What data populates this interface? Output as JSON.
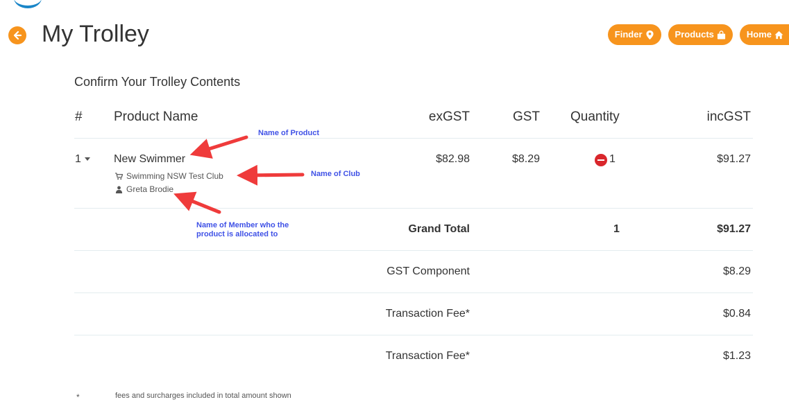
{
  "header": {
    "title": "My Trolley",
    "back_icon": "arrow-left-circle-icon",
    "nav": [
      {
        "label": "Finder",
        "icon": "map-marker-icon"
      },
      {
        "label": "Products",
        "icon": "shopping-bag-icon"
      },
      {
        "label": "Home",
        "icon": "home-icon"
      }
    ],
    "accent_color": "#f7941d"
  },
  "section_title": "Confirm Your Trolley Contents",
  "table": {
    "columns": [
      "#",
      "Product Name",
      "exGST",
      "GST",
      "Quantity",
      "incGST"
    ],
    "items": [
      {
        "index": "1",
        "product": "New Swimmer",
        "club": "Swimming NSW Test Club",
        "member": "Greta Brodie",
        "exgst": "$82.98",
        "gst": "$8.29",
        "quantity": "1",
        "incgst": "$91.27"
      }
    ],
    "grand_total": {
      "label": "Grand Total",
      "quantity": "1",
      "amount": "$91.27"
    },
    "gst_component": {
      "label": "GST Component",
      "amount": "$8.29"
    },
    "fees": [
      {
        "label": "Transaction Fee*",
        "amount": "$0.84"
      },
      {
        "label": "Transaction Fee*",
        "amount": "$1.23"
      }
    ]
  },
  "annotations": {
    "product": "Name of Product",
    "club": "Name of Club",
    "member_line1": "Name of Member who the",
    "member_line2": "product is allocated to",
    "color": "#3f51e6"
  },
  "footnote": {
    "symbol": "*",
    "text": "fees and surcharges included in total amount shown"
  }
}
